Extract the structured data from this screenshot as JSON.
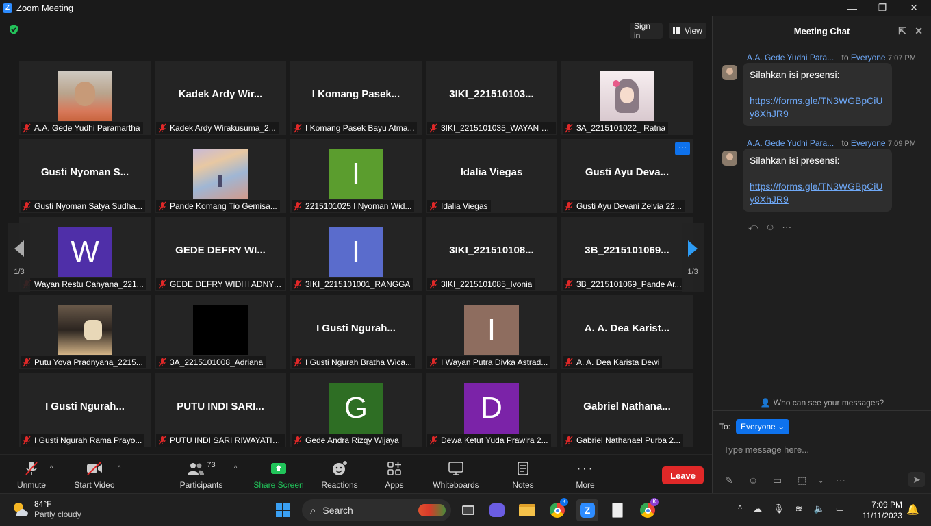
{
  "window": {
    "title": "Zoom Meeting",
    "minimize": "—",
    "maximize": "❐",
    "close": "✕"
  },
  "top": {
    "sign_in": "Sign in",
    "view": "View"
  },
  "grid": {
    "page_indicator": "1/3",
    "tiles": [
      {
        "label": "A.A. Gede Yudhi Paramartha",
        "name": "",
        "kind": "photo-person"
      },
      {
        "label": "Kadek Ardy Wirakusuma_2...",
        "name": "Kadek Ardy Wir...",
        "kind": "name"
      },
      {
        "label": "I Komang Pasek Bayu Atma...",
        "name": "I Komang Pasek...",
        "kind": "name"
      },
      {
        "label": "3IKI_2215101035_WAYAN REST...",
        "name": "3IKI_221510103...",
        "kind": "name"
      },
      {
        "label": "3A_2215101022_ Ratna",
        "name": "",
        "kind": "photo-anime"
      },
      {
        "label": "Gusti Nyoman Satya Sudha...",
        "name": "Gusti Nyoman S...",
        "kind": "name"
      },
      {
        "label": "Pande Komang Tio Gemisa...",
        "name": "",
        "kind": "photo-painting"
      },
      {
        "label": "2215101025 I Nyoman Wid...",
        "name": "",
        "kind": "letter",
        "letter": "I",
        "color": "#5b9d2e"
      },
      {
        "label": "Idalia Viegas",
        "name": "Idalia Viegas",
        "kind": "name"
      },
      {
        "label": "Gusti Ayu Devani Zelvia 22...",
        "name": "Gusti Ayu Deva...",
        "kind": "name",
        "more": "···"
      },
      {
        "label": "Wayan Restu Cahyana_221...",
        "name": "",
        "kind": "letter",
        "letter": "W",
        "color": "#4f2fa8"
      },
      {
        "label": "GEDE DEFRY WIDHI ADNYA...",
        "name": "GEDE DEFRY WI...",
        "kind": "name"
      },
      {
        "label": "3IKI_2215101001_RANGGA",
        "name": "",
        "kind": "letter",
        "letter": "I",
        "color": "#5a6ccc"
      },
      {
        "label": "3IKI_2215101085_Ivonia",
        "name": "3IKI_221510108...",
        "kind": "name"
      },
      {
        "label": "3B_2215101069_Pande Ar...",
        "name": "3B_2215101069...",
        "kind": "name"
      },
      {
        "label": "Putu Yova Pradnyana_2215...",
        "name": "",
        "kind": "photo-desk"
      },
      {
        "label": "3A_2215101008_Adriana",
        "name": "",
        "kind": "black"
      },
      {
        "label": "I Gusti Ngurah Bratha Wica...",
        "name": "I Gusti Ngurah...",
        "kind": "name"
      },
      {
        "label": "I Wayan Putra Divka Astrad...",
        "name": "",
        "kind": "letter",
        "letter": "I",
        "color": "#8e6d5f"
      },
      {
        "label": "A. A. Dea Karista Dewi",
        "name": "A. A. Dea Karist...",
        "kind": "name"
      },
      {
        "label": "I Gusti Ngurah Rama Prayo...",
        "name": "I Gusti Ngurah...",
        "kind": "name"
      },
      {
        "label": "PUTU INDI SARI RIWAYATI 2...",
        "name": "PUTU INDI SARI...",
        "kind": "name"
      },
      {
        "label": "Gede Andra Rizqy Wijaya",
        "name": "",
        "kind": "letter",
        "letter": "G",
        "color": "#2e6e24"
      },
      {
        "label": "Dewa Ketut Yuda Prawira 2...",
        "name": "",
        "kind": "letter",
        "letter": "D",
        "color": "#7b23a8"
      },
      {
        "label": "Gabriel Nathanael Purba 2...",
        "name": "Gabriel Nathana...",
        "kind": "name"
      }
    ]
  },
  "toolbar": {
    "unmute": "Unmute",
    "start_video": "Start Video",
    "participants": "Participants",
    "participants_count": "73",
    "share_screen": "Share Screen",
    "reactions": "Reactions",
    "apps": "Apps",
    "whiteboards": "Whiteboards",
    "notes": "Notes",
    "more": "More",
    "leave": "Leave"
  },
  "chat": {
    "title": "Meeting Chat",
    "messages": [
      {
        "sender": "A.A. Gede Yudhi Para...",
        "to_prefix": "to",
        "to": "Everyone",
        "time": "7:07 PM",
        "text": "Silahkan isi presensi:",
        "link": "https://forms.gle/TN3WGBpCiUy8XhJR9"
      },
      {
        "sender": "A.A. Gede Yudhi Para...",
        "to_prefix": "to",
        "to": "Everyone",
        "time": "7:09 PM",
        "text": "Silahkan isi presensi:",
        "link": "https://forms.gle/TN3WGBpCiUy8XhJR9"
      }
    ],
    "who_can_see": "Who can see your messages?",
    "to_label": "To:",
    "to_value": "Everyone",
    "input_placeholder": "Type message here..."
  },
  "taskbar": {
    "weather_temp": "84°F",
    "weather_desc": "Partly cloudy",
    "search": "Search",
    "time": "7:09 PM",
    "date": "11/11/2023",
    "badge_k": "K"
  },
  "colors": {
    "accent": "#0e72ed",
    "leave": "#e02828",
    "share": "#21c45a",
    "link": "#6ea8f7"
  }
}
